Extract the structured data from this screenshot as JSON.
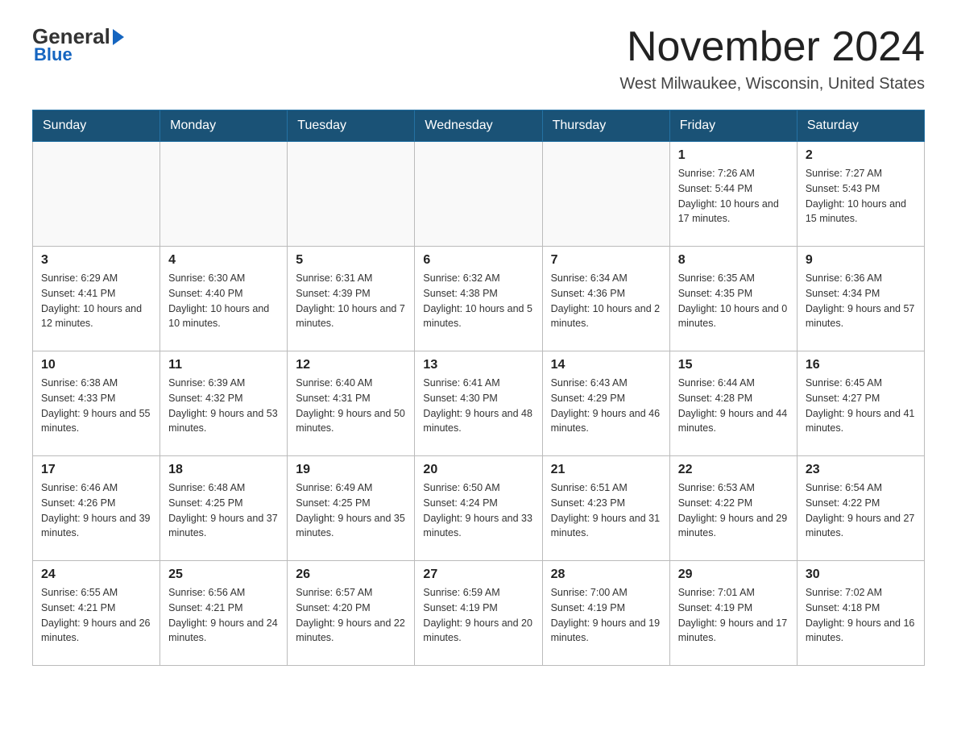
{
  "logo": {
    "general": "General",
    "blue": "Blue"
  },
  "header": {
    "month": "November 2024",
    "location": "West Milwaukee, Wisconsin, United States"
  },
  "weekdays": [
    "Sunday",
    "Monday",
    "Tuesday",
    "Wednesday",
    "Thursday",
    "Friday",
    "Saturday"
  ],
  "weeks": [
    [
      {
        "day": "",
        "sunrise": "",
        "sunset": "",
        "daylight": ""
      },
      {
        "day": "",
        "sunrise": "",
        "sunset": "",
        "daylight": ""
      },
      {
        "day": "",
        "sunrise": "",
        "sunset": "",
        "daylight": ""
      },
      {
        "day": "",
        "sunrise": "",
        "sunset": "",
        "daylight": ""
      },
      {
        "day": "",
        "sunrise": "",
        "sunset": "",
        "daylight": ""
      },
      {
        "day": "1",
        "sunrise": "Sunrise: 7:26 AM",
        "sunset": "Sunset: 5:44 PM",
        "daylight": "Daylight: 10 hours and 17 minutes."
      },
      {
        "day": "2",
        "sunrise": "Sunrise: 7:27 AM",
        "sunset": "Sunset: 5:43 PM",
        "daylight": "Daylight: 10 hours and 15 minutes."
      }
    ],
    [
      {
        "day": "3",
        "sunrise": "Sunrise: 6:29 AM",
        "sunset": "Sunset: 4:41 PM",
        "daylight": "Daylight: 10 hours and 12 minutes."
      },
      {
        "day": "4",
        "sunrise": "Sunrise: 6:30 AM",
        "sunset": "Sunset: 4:40 PM",
        "daylight": "Daylight: 10 hours and 10 minutes."
      },
      {
        "day": "5",
        "sunrise": "Sunrise: 6:31 AM",
        "sunset": "Sunset: 4:39 PM",
        "daylight": "Daylight: 10 hours and 7 minutes."
      },
      {
        "day": "6",
        "sunrise": "Sunrise: 6:32 AM",
        "sunset": "Sunset: 4:38 PM",
        "daylight": "Daylight: 10 hours and 5 minutes."
      },
      {
        "day": "7",
        "sunrise": "Sunrise: 6:34 AM",
        "sunset": "Sunset: 4:36 PM",
        "daylight": "Daylight: 10 hours and 2 minutes."
      },
      {
        "day": "8",
        "sunrise": "Sunrise: 6:35 AM",
        "sunset": "Sunset: 4:35 PM",
        "daylight": "Daylight: 10 hours and 0 minutes."
      },
      {
        "day": "9",
        "sunrise": "Sunrise: 6:36 AM",
        "sunset": "Sunset: 4:34 PM",
        "daylight": "Daylight: 9 hours and 57 minutes."
      }
    ],
    [
      {
        "day": "10",
        "sunrise": "Sunrise: 6:38 AM",
        "sunset": "Sunset: 4:33 PM",
        "daylight": "Daylight: 9 hours and 55 minutes."
      },
      {
        "day": "11",
        "sunrise": "Sunrise: 6:39 AM",
        "sunset": "Sunset: 4:32 PM",
        "daylight": "Daylight: 9 hours and 53 minutes."
      },
      {
        "day": "12",
        "sunrise": "Sunrise: 6:40 AM",
        "sunset": "Sunset: 4:31 PM",
        "daylight": "Daylight: 9 hours and 50 minutes."
      },
      {
        "day": "13",
        "sunrise": "Sunrise: 6:41 AM",
        "sunset": "Sunset: 4:30 PM",
        "daylight": "Daylight: 9 hours and 48 minutes."
      },
      {
        "day": "14",
        "sunrise": "Sunrise: 6:43 AM",
        "sunset": "Sunset: 4:29 PM",
        "daylight": "Daylight: 9 hours and 46 minutes."
      },
      {
        "day": "15",
        "sunrise": "Sunrise: 6:44 AM",
        "sunset": "Sunset: 4:28 PM",
        "daylight": "Daylight: 9 hours and 44 minutes."
      },
      {
        "day": "16",
        "sunrise": "Sunrise: 6:45 AM",
        "sunset": "Sunset: 4:27 PM",
        "daylight": "Daylight: 9 hours and 41 minutes."
      }
    ],
    [
      {
        "day": "17",
        "sunrise": "Sunrise: 6:46 AM",
        "sunset": "Sunset: 4:26 PM",
        "daylight": "Daylight: 9 hours and 39 minutes."
      },
      {
        "day": "18",
        "sunrise": "Sunrise: 6:48 AM",
        "sunset": "Sunset: 4:25 PM",
        "daylight": "Daylight: 9 hours and 37 minutes."
      },
      {
        "day": "19",
        "sunrise": "Sunrise: 6:49 AM",
        "sunset": "Sunset: 4:25 PM",
        "daylight": "Daylight: 9 hours and 35 minutes."
      },
      {
        "day": "20",
        "sunrise": "Sunrise: 6:50 AM",
        "sunset": "Sunset: 4:24 PM",
        "daylight": "Daylight: 9 hours and 33 minutes."
      },
      {
        "day": "21",
        "sunrise": "Sunrise: 6:51 AM",
        "sunset": "Sunset: 4:23 PM",
        "daylight": "Daylight: 9 hours and 31 minutes."
      },
      {
        "day": "22",
        "sunrise": "Sunrise: 6:53 AM",
        "sunset": "Sunset: 4:22 PM",
        "daylight": "Daylight: 9 hours and 29 minutes."
      },
      {
        "day": "23",
        "sunrise": "Sunrise: 6:54 AM",
        "sunset": "Sunset: 4:22 PM",
        "daylight": "Daylight: 9 hours and 27 minutes."
      }
    ],
    [
      {
        "day": "24",
        "sunrise": "Sunrise: 6:55 AM",
        "sunset": "Sunset: 4:21 PM",
        "daylight": "Daylight: 9 hours and 26 minutes."
      },
      {
        "day": "25",
        "sunrise": "Sunrise: 6:56 AM",
        "sunset": "Sunset: 4:21 PM",
        "daylight": "Daylight: 9 hours and 24 minutes."
      },
      {
        "day": "26",
        "sunrise": "Sunrise: 6:57 AM",
        "sunset": "Sunset: 4:20 PM",
        "daylight": "Daylight: 9 hours and 22 minutes."
      },
      {
        "day": "27",
        "sunrise": "Sunrise: 6:59 AM",
        "sunset": "Sunset: 4:19 PM",
        "daylight": "Daylight: 9 hours and 20 minutes."
      },
      {
        "day": "28",
        "sunrise": "Sunrise: 7:00 AM",
        "sunset": "Sunset: 4:19 PM",
        "daylight": "Daylight: 9 hours and 19 minutes."
      },
      {
        "day": "29",
        "sunrise": "Sunrise: 7:01 AM",
        "sunset": "Sunset: 4:19 PM",
        "daylight": "Daylight: 9 hours and 17 minutes."
      },
      {
        "day": "30",
        "sunrise": "Sunrise: 7:02 AM",
        "sunset": "Sunset: 4:18 PM",
        "daylight": "Daylight: 9 hours and 16 minutes."
      }
    ]
  ]
}
